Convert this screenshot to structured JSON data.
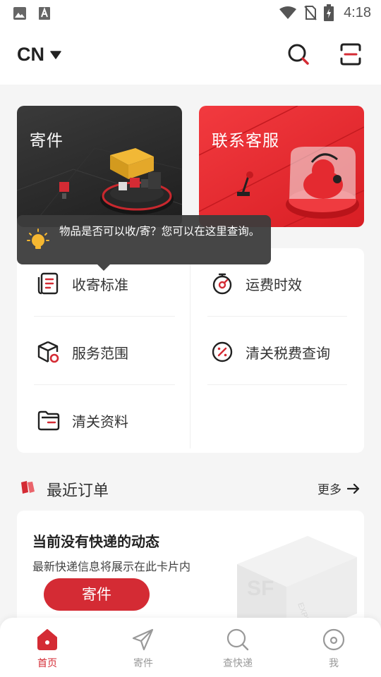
{
  "status_bar": {
    "time": "4:18"
  },
  "header": {
    "region": "CN"
  },
  "banners": [
    {
      "title": "寄件"
    },
    {
      "title": "联系客服"
    }
  ],
  "tooltip": {
    "text": "物品是否可以收/寄？您可以在这里查询。"
  },
  "services": [
    {
      "label": "收寄标准"
    },
    {
      "label": "运费时效"
    },
    {
      "label": "服务范围"
    },
    {
      "label": "清关税费查询"
    },
    {
      "label": "清关资料"
    }
  ],
  "recent_orders": {
    "title": "最近订单",
    "more": "更多",
    "empty_title": "当前没有快递的动态",
    "empty_subtitle": "最新快递信息将展示在此卡片内",
    "send_button": "寄件"
  },
  "tabbar": {
    "tabs": [
      {
        "label": "首页",
        "active": true
      },
      {
        "label": "寄件",
        "active": false
      },
      {
        "label": "查快递",
        "active": false
      },
      {
        "label": "我",
        "active": false
      }
    ]
  },
  "colors": {
    "brand_red": "#d42b34",
    "dark_banner": "#2a2a2a",
    "red_banner": "#e8282e"
  }
}
